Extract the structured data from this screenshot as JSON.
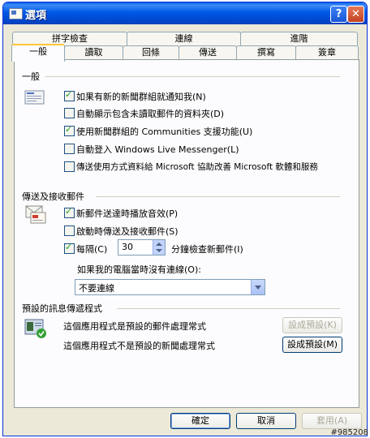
{
  "window": {
    "title": "選項"
  },
  "tabs": {
    "row1": [
      "拼字檢查",
      "連線",
      "進階"
    ],
    "row2": [
      "一般",
      "讀取",
      "回條",
      "傳送",
      "撰寫",
      "簽章"
    ],
    "active": "一般"
  },
  "general": {
    "title": "一般",
    "options": [
      {
        "label": "如果有新的新聞群組就通知我(N)",
        "checked": true
      },
      {
        "label": "自動顯示包含未讀取郵件的資料夾(D)",
        "checked": false
      },
      {
        "label": "使用新聞群組的 Communities 支援功能(U)",
        "checked": true
      },
      {
        "label": "自動登入 Windows Live Messenger(L)",
        "checked": false
      },
      {
        "label": "傳送使用方式資料給 Microsoft 協助改善 Microsoft 軟體和服務",
        "checked": false
      }
    ]
  },
  "send_receive": {
    "title": "傳送及接收郵件",
    "options": [
      {
        "label": "新郵件送達時播放音效(P)",
        "checked": true
      },
      {
        "label": "啟動時傳送及接收郵件(S)",
        "checked": false
      }
    ],
    "every_label": "每隔(C)",
    "every_checked": true,
    "every_value": "30",
    "every_suffix": "分鐘檢查新郵件(I)",
    "offline_label": "如果我的電腦當時沒有連線(O):",
    "offline_value": "不要連線"
  },
  "default_messaging": {
    "title": "預設的訊息傳遞程式",
    "mail_text": "這個應用程式是預設的郵件處理常式",
    "mail_button": "設成預設(K)",
    "news_text": "這個應用程式不是預設的新聞處理常式",
    "news_button": "設成預設(M)"
  },
  "buttons": {
    "ok": "確定",
    "cancel": "取消",
    "apply": "套用(A)"
  },
  "watermark": "#985208"
}
